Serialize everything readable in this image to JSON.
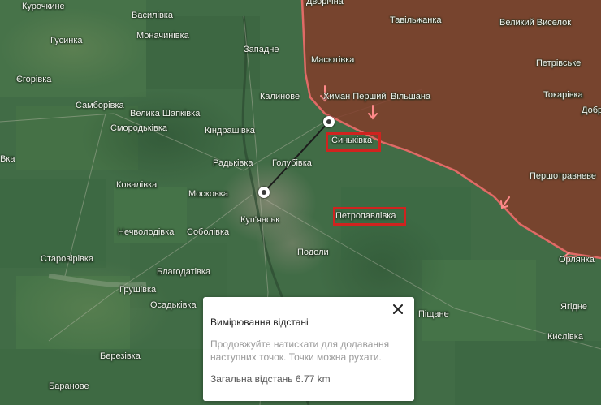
{
  "map": {
    "place_labels": [
      {
        "text": "Курочкине"
      },
      {
        "text": "Василівка"
      },
      {
        "text": "Дворічна"
      },
      {
        "text": "Тавільжанка"
      },
      {
        "text": "Великий Виселок"
      },
      {
        "text": "Гусинка"
      },
      {
        "text": "Моначинівка"
      },
      {
        "text": "Западне"
      },
      {
        "text": "Масютівка"
      },
      {
        "text": "Петрівське"
      },
      {
        "text": "Єгорівка"
      },
      {
        "text": "Калинове"
      },
      {
        "text": "Химан Перший"
      },
      {
        "text": "Вільшана"
      },
      {
        "text": "Токарівка"
      },
      {
        "text": "Самборівка"
      },
      {
        "text": "Велика Шапківка"
      },
      {
        "text": "Добр"
      },
      {
        "text": "Смородьківка"
      },
      {
        "text": "Кіндрашівка"
      },
      {
        "text": "Синьківка"
      },
      {
        "text": "Радьківка"
      },
      {
        "text": "Голубівка"
      },
      {
        "text": "Першотравневе"
      },
      {
        "text": "Ковалівка"
      },
      {
        "text": "Московка"
      },
      {
        "text": "Вка"
      },
      {
        "text": "Куп'янськ"
      },
      {
        "text": "Петропавлівка"
      },
      {
        "text": "Нечволодівка"
      },
      {
        "text": "Соболівка"
      },
      {
        "text": "Старовірівка"
      },
      {
        "text": "Подоли"
      },
      {
        "text": "Орлянка"
      },
      {
        "text": "Благодатівка"
      },
      {
        "text": "Грушівка"
      },
      {
        "text": "Осадьківка"
      },
      {
        "text": "Піщане"
      },
      {
        "text": "Ягідне"
      },
      {
        "text": "Кислівка"
      },
      {
        "text": "Березівка"
      },
      {
        "text": "Баранове"
      }
    ],
    "highlighted": [
      "Синьківка",
      "Петропавлівка"
    ],
    "colors": {
      "terrain": "#3f6a44",
      "occupied_overlay": "#8c3b2a",
      "frontline": "#e06a66",
      "highlight_box": "#d0231f",
      "advance_arrow": "#ff8a8a"
    },
    "measure_points": 2
  },
  "panel": {
    "title": "Вимірювання відстані",
    "hint": "Продовжуйте натискати для додавання наступних точок. Точки можна рухати.",
    "total": "Загальна відстань 6.77 km",
    "close_icon": "close-icon"
  }
}
